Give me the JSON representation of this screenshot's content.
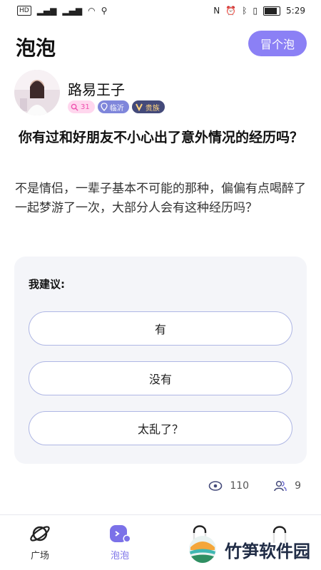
{
  "status_bar": {
    "network_label": "HD",
    "time": "5:29"
  },
  "header": {
    "title": "泡泡",
    "action_label": "冒个泡"
  },
  "post": {
    "username": "路易王子",
    "badges": [
      {
        "icon": "search-icon",
        "text": "31"
      },
      {
        "icon": "location-icon",
        "text": "临沂"
      },
      {
        "icon": "v-icon",
        "text": "贵族"
      }
    ],
    "question": "你有过和好朋友不小心出了意外情况的经历吗？",
    "content": " 不是情侣，一辈子基本不可能的那种，偏偏有点喝醉了一起梦游了一次，大部分人会有这种经历吗？"
  },
  "suggestion": {
    "title": "我建议:",
    "options": [
      "有",
      "没有",
      "太乱了？"
    ]
  },
  "stats": {
    "views": "110",
    "participants": "9"
  },
  "tabbar": {
    "tabs": [
      {
        "label": "广场",
        "icon": "planet-icon"
      },
      {
        "label": "泡泡",
        "icon": "bubble-icon",
        "active": true
      },
      {
        "label": "",
        "icon": "bag-icon"
      },
      {
        "label": "",
        "icon": "profile-icon"
      }
    ]
  },
  "watermark": {
    "text": "竹笋软件园"
  },
  "colors": {
    "accent": "#8b80f5",
    "card_bg": "#f4f5f9",
    "option_border": "#aeb6e4"
  }
}
